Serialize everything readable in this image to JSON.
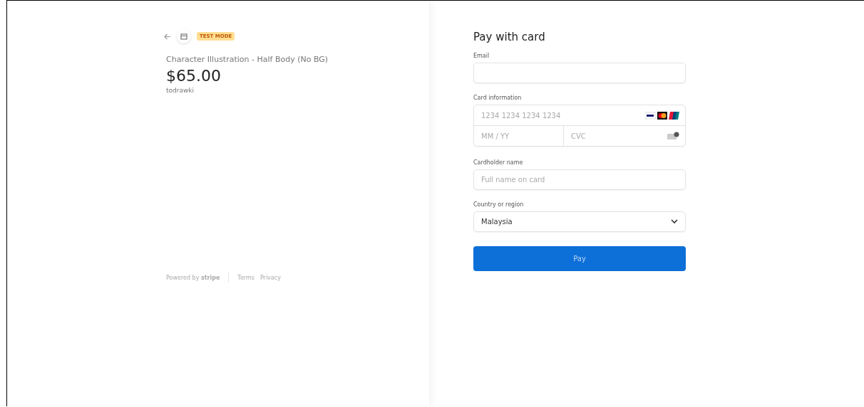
{
  "product": {
    "badge": "TEST MODE",
    "name": "Character Illustration - Half Body (No BG)",
    "price": "$65.00",
    "seller": "todrawki"
  },
  "footer": {
    "powered": "Powered by **stripe**",
    "links": [
      "Terms",
      "Privacy"
    ]
  },
  "form": {
    "title": "Pay with card",
    "email": {
      "label": "Email"
    },
    "card": {
      "label": "Card information",
      "number_placeholder": "1234 1234 1234 1234",
      "expiry_placeholder": "MM / YY",
      "cvc_placeholder": "CVC"
    },
    "cardholder": {
      "label": "Cardholder name",
      "placeholder": "Full name on card"
    },
    "country": {
      "label": "Country or region",
      "value": "Malaysia"
    },
    "pay_button": "Pay"
  }
}
